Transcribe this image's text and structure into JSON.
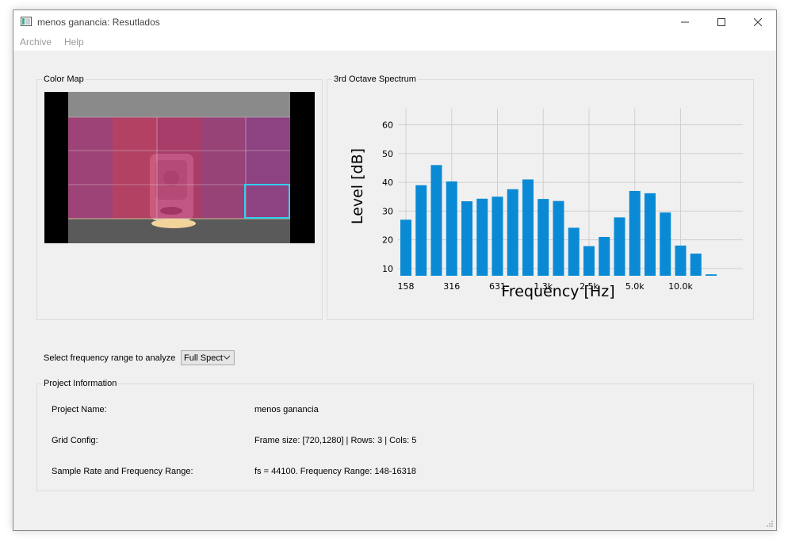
{
  "window": {
    "title": "menos ganancia: Resutlados",
    "controls": {
      "minimize": "minimize-icon",
      "maximize": "maximize-icon",
      "close": "close-icon"
    }
  },
  "menu": {
    "items": [
      "Archive",
      "Help"
    ]
  },
  "color_map": {
    "title": "Color Map"
  },
  "spectrum": {
    "title": "3rd Octave Spectrum"
  },
  "range_select": {
    "label": "Select frequency range to analyze",
    "value": "Full Spect"
  },
  "project_info": {
    "title": "Project Information",
    "rows": [
      {
        "label": "Project Name:",
        "value": "menos ganancia"
      },
      {
        "label": "Grid Config:",
        "value": "Frame size: [720,1280] | Rows: 3 | Cols: 5"
      },
      {
        "label": "Sample Rate and Frequency Range:",
        "value": "fs = 44100. Frequency Range: 148-16318"
      }
    ]
  },
  "colors": {
    "bar": "#0a8ad4",
    "overlay": "#c0306a",
    "highlight": "#33d0f0"
  },
  "chart_data": {
    "type": "bar",
    "title": "",
    "xlabel": "Frequency [Hz]",
    "ylabel": "Level [dB]",
    "ylim": [
      7.5,
      64
    ],
    "yticks": [
      10,
      20,
      30,
      40,
      50,
      60
    ],
    "xtick_labels": [
      "158",
      "316",
      "631",
      "1.3k",
      "2.5k",
      "5.0k",
      "10.0k"
    ],
    "xtick_bar_index": [
      0,
      3,
      6,
      9,
      12,
      15,
      18
    ],
    "grid": true,
    "values": [
      27,
      39,
      46,
      40.3,
      33.4,
      34.3,
      35,
      37.6,
      41,
      34.2,
      33.5,
      24.2,
      17.8,
      21,
      27.8,
      37,
      36.2,
      29.5,
      18,
      15.2,
      8
    ]
  }
}
